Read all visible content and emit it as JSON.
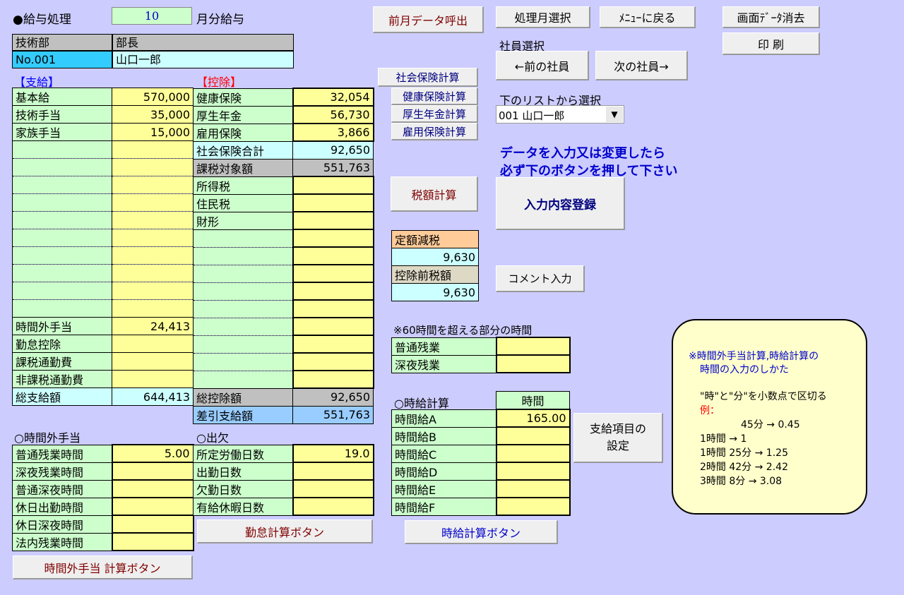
{
  "header": {
    "title": "●給与処理",
    "month_value": "10",
    "month_suffix": "月分給与"
  },
  "employee": {
    "dept": "技術部",
    "position": "部長",
    "no": "No.001",
    "name": "山口一郎"
  },
  "pay": {
    "heading": "【支給】",
    "rows": [
      {
        "label": "基本給",
        "value": "570,000"
      },
      {
        "label": "技術手当",
        "value": "35,000"
      },
      {
        "label": "家族手当",
        "value": "15,000"
      },
      {
        "label": "",
        "value": ""
      },
      {
        "label": "",
        "value": ""
      },
      {
        "label": "",
        "value": ""
      },
      {
        "label": "",
        "value": ""
      },
      {
        "label": "",
        "value": ""
      },
      {
        "label": "",
        "value": ""
      },
      {
        "label": "",
        "value": ""
      },
      {
        "label": "",
        "value": ""
      },
      {
        "label": "",
        "value": ""
      },
      {
        "label": "",
        "value": ""
      },
      {
        "label": "時間外手当",
        "value": "24,413"
      },
      {
        "label": "勤怠控除",
        "value": ""
      },
      {
        "label": "課税通勤費",
        "value": ""
      },
      {
        "label": "非課税通勤費",
        "value": ""
      }
    ],
    "total_label": "総支給額",
    "total_value": "644,413"
  },
  "deduct": {
    "heading": "【控除】",
    "rows": [
      {
        "label": "健康保険",
        "value": "32,054"
      },
      {
        "label": "厚生年金",
        "value": "56,730"
      },
      {
        "label": "雇用保険",
        "value": "3,866"
      }
    ],
    "social_total_label": "社会保険合計",
    "social_total_value": "92,650",
    "taxable_label": "課税対象額",
    "taxable_value": "551,763",
    "tax_rows": [
      {
        "label": "所得税",
        "value": ""
      },
      {
        "label": "住民税",
        "value": ""
      },
      {
        "label": "財形",
        "value": ""
      },
      {
        "label": "",
        "value": ""
      },
      {
        "label": "",
        "value": ""
      },
      {
        "label": "",
        "value": ""
      },
      {
        "label": "",
        "value": ""
      },
      {
        "label": "",
        "value": ""
      },
      {
        "label": "",
        "value": ""
      },
      {
        "label": "",
        "value": ""
      },
      {
        "label": "",
        "value": ""
      },
      {
        "label": "",
        "value": ""
      }
    ],
    "total_label": "総控除額",
    "total_value": "92,650",
    "net_label": "差引支給額",
    "net_value": "551,763"
  },
  "overtime": {
    "heading": "○時間外手当",
    "rows": [
      {
        "label": "普通残業時間",
        "value": "5.00"
      },
      {
        "label": "深夜残業時間",
        "value": ""
      },
      {
        "label": "普通深夜時間",
        "value": ""
      },
      {
        "label": "休日出勤時間",
        "value": ""
      },
      {
        "label": "休日深夜時間",
        "value": ""
      },
      {
        "label": "法内残業時間",
        "value": ""
      }
    ],
    "button": "時間外手当 計算ボタン"
  },
  "attendance": {
    "heading": "○出欠",
    "rows": [
      {
        "label": "所定労働日数",
        "value": "19.0"
      },
      {
        "label": "出勤日数",
        "value": ""
      },
      {
        "label": "欠勤日数",
        "value": ""
      },
      {
        "label": "有給休暇日数",
        "value": ""
      }
    ],
    "button": "勤怠計算ボタン"
  },
  "social_buttons": {
    "main": "社会保険計算",
    "health": "健康保険計算",
    "pension": "厚生年金計算",
    "employment": "雇用保険計算"
  },
  "tax_calc_button": "税額計算",
  "fixed_tax": {
    "label1": "定額減税",
    "value1": "9,630",
    "label2": "控除前税額",
    "value2": "9,630"
  },
  "over60": {
    "heading": "※60時間を超える部分の時間",
    "rows": [
      {
        "label": "普通残業",
        "value": ""
      },
      {
        "label": "深夜残業",
        "value": ""
      }
    ]
  },
  "hourly": {
    "heading": "○時給計算",
    "col_header": "時間",
    "rows": [
      {
        "label": "時間給A",
        "value": "165.00"
      },
      {
        "label": "時間給B",
        "value": ""
      },
      {
        "label": "時間給C",
        "value": ""
      },
      {
        "label": "時間給D",
        "value": ""
      },
      {
        "label": "時間給E",
        "value": ""
      },
      {
        "label": "時間給F",
        "value": ""
      }
    ],
    "button": "時給計算ボタン"
  },
  "top_buttons": {
    "prev_month_data": "前月データ呼出",
    "select_month": "処理月選択",
    "back_to_menu": "ﾒﾆｭｰに戻る",
    "clear_data": "画面ﾃﾞｰﾀ消去",
    "print": "印 刷"
  },
  "employee_select": {
    "label": "社員選択",
    "prev": "←前の社員",
    "next": "次の社員→",
    "list_label": "下のリストから選択",
    "selected": "001 山口一郎"
  },
  "notice": {
    "line1": "データを入力又は変更したら",
    "line2": "必ず下のボタンを押して下さい"
  },
  "register_button": "入力内容登録",
  "comment_button": "コメント入力",
  "pay_item_settings_button": {
    "line1": "支給項目の",
    "line2": "設定"
  },
  "help": {
    "title1": "※時間外手当計算,時給計算の",
    "title2": "時間の入力のしかた",
    "line": "\"時\"と\"分\"を小数点で区切る",
    "example_label": "例：",
    "examples": [
      "45分 → 0.45",
      "1時間 → 1",
      "1時間 25分 → 1.25",
      "2時間 42分 → 2.42",
      "3時間 8分 → 3.08"
    ]
  },
  "colors": {
    "background": "#ccccff",
    "label_cell": "#ccffcc",
    "input_cell": "#ffff99",
    "notice_text": "#0000cc",
    "heading_red": "#ff0000",
    "heading_blue": "#0000ff"
  }
}
